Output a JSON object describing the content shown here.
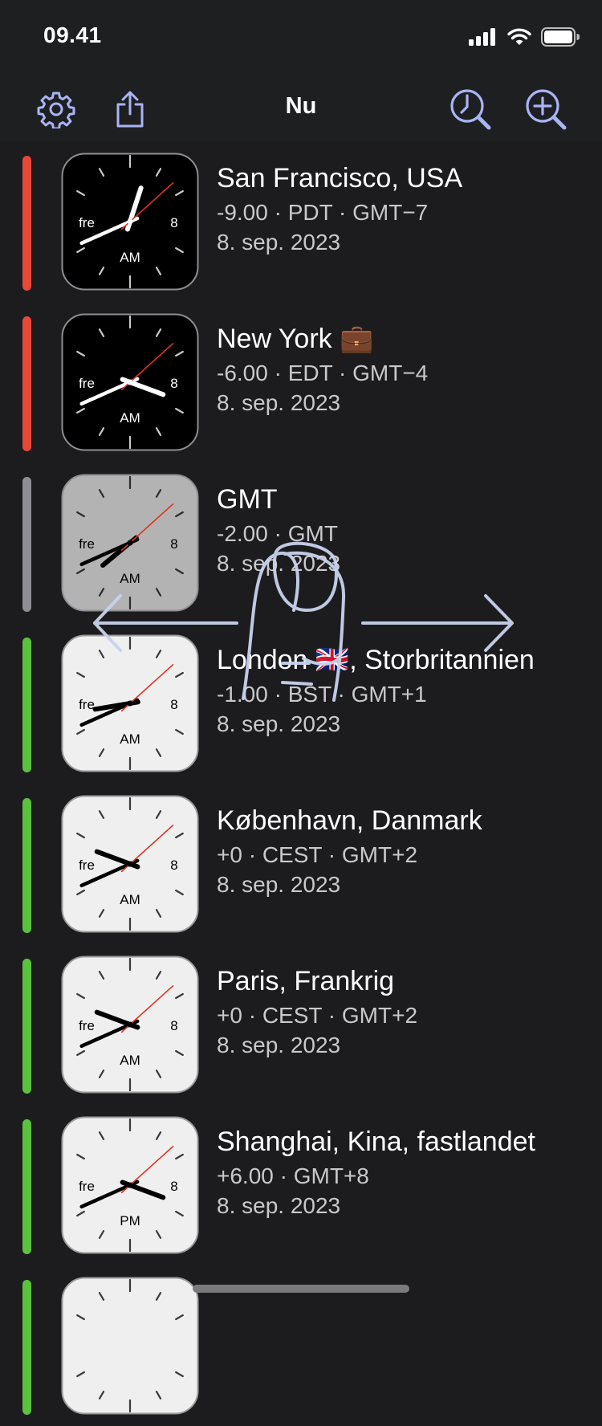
{
  "status": {
    "time": "09.41",
    "icons": [
      "cellular-signal-icon",
      "wifi-icon",
      "battery-icon"
    ]
  },
  "nav": {
    "title": "Nu",
    "left_icons": [
      "gear-icon",
      "share-icon"
    ],
    "right_icons": [
      "clock-search-icon",
      "zoom-in-icon"
    ],
    "accent": "#a9b4f5"
  },
  "clocks": [
    {
      "city": "San Francisco, USA",
      "offset": "-9.00",
      "zone": "PDT",
      "gmt": "GMT−7",
      "date": "8. sep. 2023",
      "ampm": "AM",
      "day": "fre",
      "theme": "dark",
      "status_color": "#e8473a",
      "hour": 0.6,
      "minute": 41,
      "second": 8
    },
    {
      "city": "New York",
      "emoji": "💼",
      "offset": "-6.00",
      "zone": "EDT",
      "gmt": "GMT−4",
      "date": "8. sep. 2023",
      "ampm": "AM",
      "day": "fre",
      "theme": "dark",
      "status_color": "#e8473a",
      "hour": 3.68,
      "minute": 41,
      "second": 8
    },
    {
      "city": "GMT",
      "offset": "-2.00",
      "zone": "GMT",
      "gmt": "",
      "date": "8. sep. 2023",
      "ampm": "AM",
      "day": "fre",
      "theme": "gray",
      "status_color": "#8e8e93",
      "hour": 7.68,
      "minute": 41,
      "second": 8
    },
    {
      "city": "London 🇬🇧, Storbritannien",
      "offset": "-1.00",
      "zone": "BST",
      "gmt": "GMT+1",
      "date": "8. sep. 2023",
      "ampm": "AM",
      "day": "fre",
      "theme": "light",
      "status_color": "#5ac23c",
      "hour": 8.68,
      "minute": 41,
      "second": 8
    },
    {
      "city": "København, Danmark",
      "offset": "+0",
      "zone": "CEST",
      "gmt": "GMT+2",
      "date": "8. sep. 2023",
      "ampm": "AM",
      "day": "fre",
      "theme": "light",
      "status_color": "#5ac23c",
      "hour": 9.68,
      "minute": 41,
      "second": 8
    },
    {
      "city": "Paris, Frankrig",
      "offset": "+0",
      "zone": "CEST",
      "gmt": "GMT+2",
      "date": "8. sep. 2023",
      "ampm": "AM",
      "day": "fre",
      "theme": "light",
      "status_color": "#5ac23c",
      "hour": 9.68,
      "minute": 41,
      "second": 8
    },
    {
      "city": "Shanghai, Kina, fastlandet",
      "offset": "+6.00",
      "zone": "",
      "gmt": "GMT+8",
      "date": "8. sep. 2023",
      "ampm": "PM",
      "day": "fre",
      "theme": "light",
      "status_color": "#5ac23c",
      "hour": 3.68,
      "minute": 41,
      "second": 8
    },
    {
      "city": "",
      "offset": "",
      "zone": "",
      "gmt": "",
      "date": "",
      "ampm": "",
      "day": "",
      "theme": "light",
      "status_color": "#5ac23c",
      "hour": 0,
      "minute": 0,
      "second": 0
    }
  ],
  "gesture": {
    "icon": "swipe-horizontal-gesture-icon"
  }
}
